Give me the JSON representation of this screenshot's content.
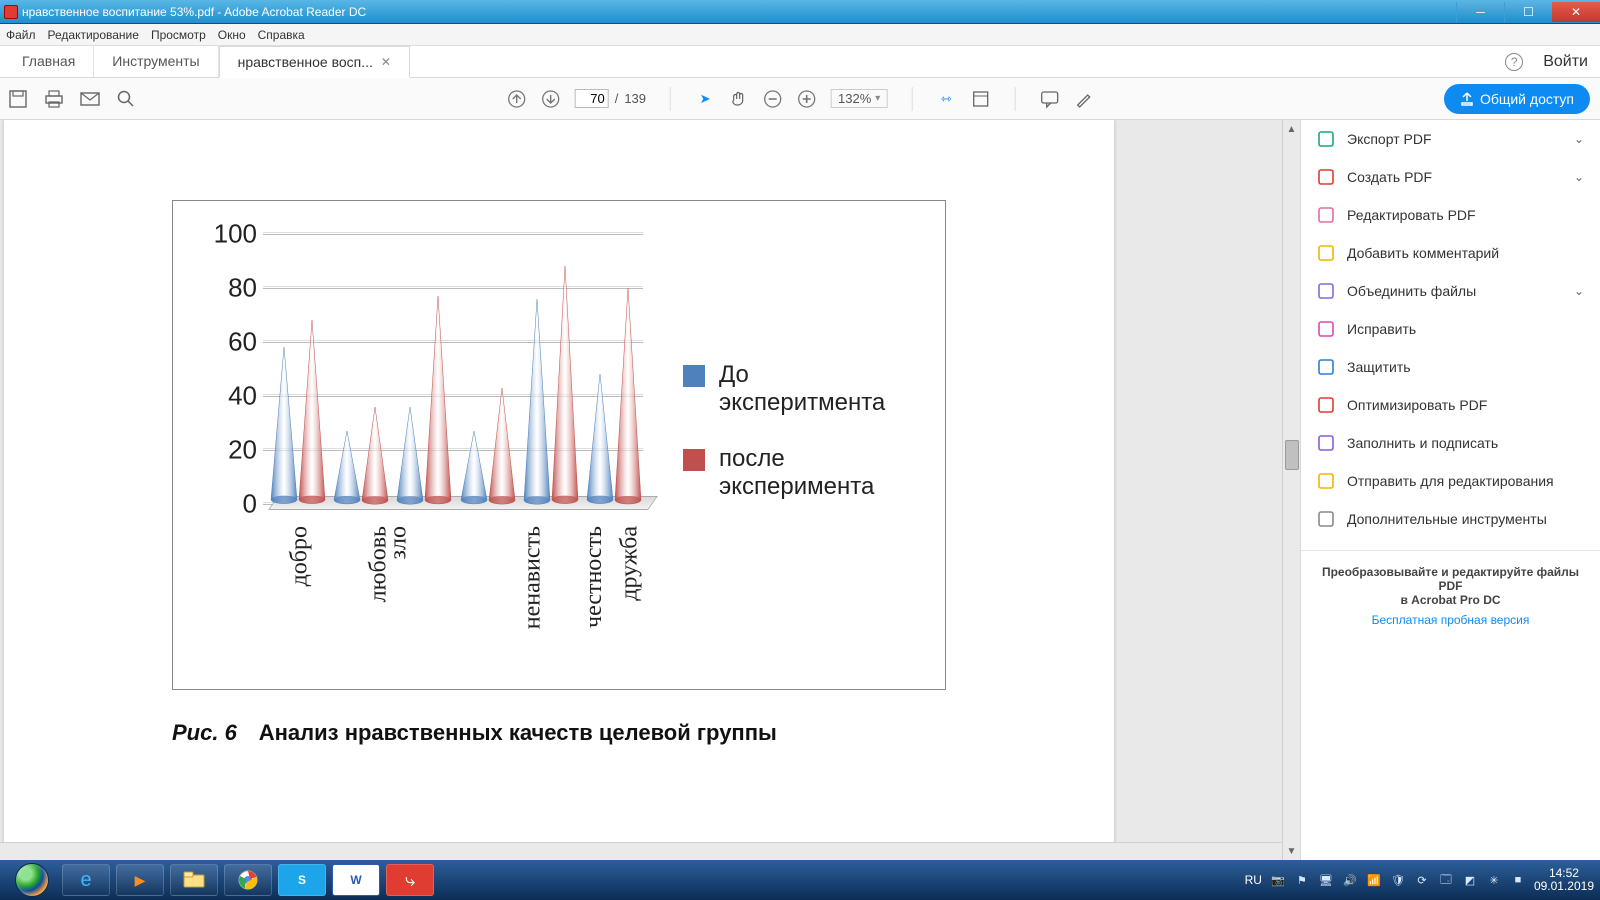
{
  "window": {
    "title": "нравственное воспитание 53%.pdf - Adobe Acrobat Reader DC"
  },
  "menubar": [
    "Файл",
    "Редактирование",
    "Просмотр",
    "Окно",
    "Справка"
  ],
  "tabs": {
    "home": "Главная",
    "tools": "Инструменты",
    "doc": "нравственное восп...",
    "login": "Войти"
  },
  "toolbar": {
    "page_current": "70",
    "page_total": "139",
    "zoom": "132%",
    "share": "Общий доступ"
  },
  "right_panel": {
    "items": [
      {
        "label": "Экспорт PDF",
        "chev": true,
        "color": "#1aa97a"
      },
      {
        "label": "Создать PDF",
        "chev": true,
        "color": "#e03c31"
      },
      {
        "label": "Редактировать PDF",
        "chev": false,
        "color": "#e86aa6"
      },
      {
        "label": "Добавить комментарий",
        "chev": false,
        "color": "#f2b500"
      },
      {
        "label": "Объединить файлы",
        "chev": true,
        "color": "#7a6ee0"
      },
      {
        "label": "Исправить",
        "chev": false,
        "color": "#d94cae"
      },
      {
        "label": "Защитить",
        "chev": false,
        "color": "#2a7de1"
      },
      {
        "label": "Оптимизировать PDF",
        "chev": false,
        "color": "#e03c31"
      },
      {
        "label": "Заполнить и подписать",
        "chev": false,
        "color": "#8a5cd6"
      },
      {
        "label": "Отправить для редактирования",
        "chev": false,
        "color": "#f2b500"
      },
      {
        "label": "Дополнительные инструменты",
        "chev": false,
        "color": "#8a8a8a"
      }
    ],
    "promo_line1": "Преобразовывайте и редактируйте файлы PDF",
    "promo_line2": "в Acrobat Pro DC",
    "promo_link": "Бесплатная пробная версия"
  },
  "chart_data": {
    "type": "bar",
    "title": "Рис. 6  Анализ нравственных качеств целевой группы",
    "categories": [
      "добро",
      "любовь",
      "зло",
      "ненависть",
      "честность",
      "дружба"
    ],
    "series": [
      {
        "name": "До эксперитмента",
        "color": "#4f81bd",
        "values": [
          58,
          27,
          36,
          27,
          76,
          48
        ]
      },
      {
        "name": "после эксперимента",
        "color": "#c0504d",
        "values": [
          68,
          36,
          77,
          43,
          88,
          80
        ]
      }
    ],
    "ylim": [
      0,
      100
    ],
    "yticks": [
      0,
      20,
      40,
      60,
      80,
      100
    ]
  },
  "taskbar": {
    "lang": "RU",
    "time": "14:52",
    "date": "09.01.2019"
  }
}
